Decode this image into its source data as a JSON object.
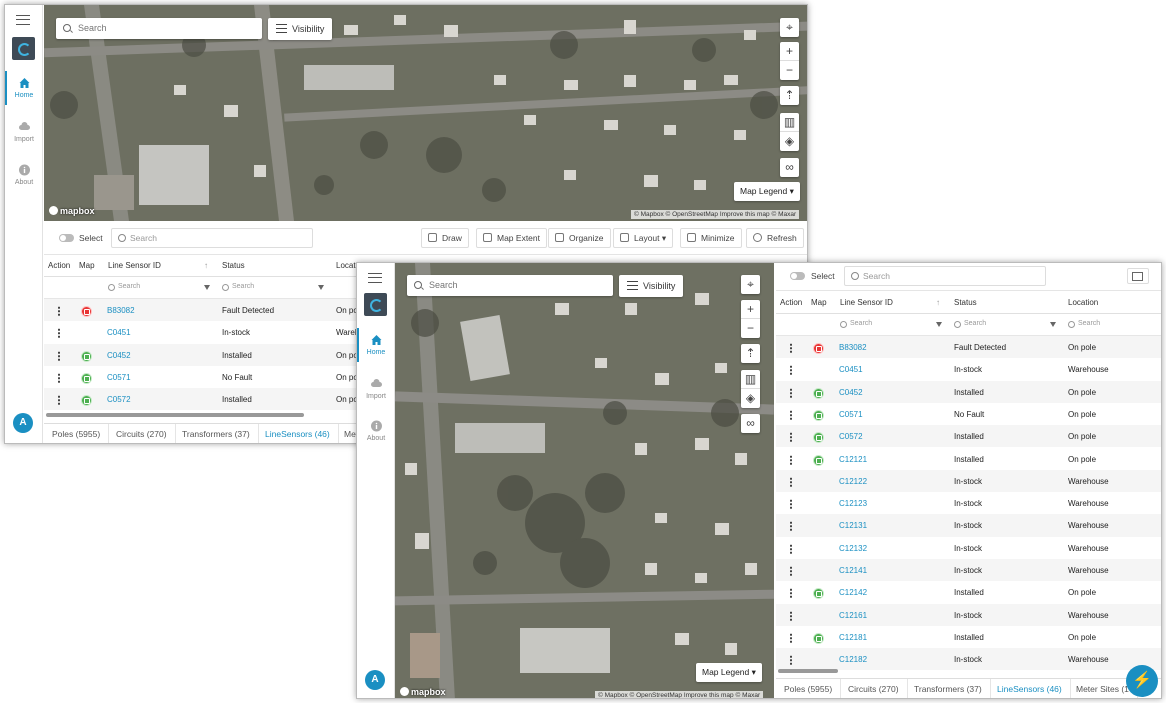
{
  "sidebar": {
    "items": [
      {
        "label": "Home"
      },
      {
        "label": "Import"
      },
      {
        "label": "About"
      }
    ],
    "avatar": "A"
  },
  "map": {
    "search_placeholder": "Search",
    "visibility_label": "Visibility",
    "legend_label": "Map Legend",
    "mapbox_logo": "mapbox",
    "attribution": "© Mapbox © OpenStreetMap Improve this map © Maxar",
    "controls": [
      "locate",
      "zoom-in",
      "zoom-out",
      "compass",
      "basemap",
      "layers",
      "binoculars"
    ]
  },
  "toolbar": {
    "select_label": "Select",
    "search_placeholder": "Search",
    "buttons": [
      "Draw",
      "Map Extent",
      "Organize",
      "Layout",
      "Minimize",
      "Refresh"
    ]
  },
  "grid": {
    "headers": [
      "Action",
      "Map",
      "Line Sensor ID",
      "Status",
      "Location"
    ],
    "filter_placeholder": "Search",
    "rows": [
      {
        "id": "B83082",
        "status": "Fault Detected",
        "location": "On pole",
        "map": "red"
      },
      {
        "id": "C0451",
        "status": "In-stock",
        "location": "Warehouse",
        "map": ""
      },
      {
        "id": "C0452",
        "status": "Installed",
        "location": "On pole",
        "map": "green"
      },
      {
        "id": "C0571",
        "status": "No Fault",
        "location": "On pole",
        "map": "green"
      },
      {
        "id": "C0572",
        "status": "Installed",
        "location": "On pole",
        "map": "green"
      },
      {
        "id": "C12121",
        "status": "Installed",
        "location": "On pole",
        "map": "green"
      },
      {
        "id": "C12122",
        "status": "In-stock",
        "location": "Warehouse",
        "map": ""
      },
      {
        "id": "C12123",
        "status": "In-stock",
        "location": "Warehouse",
        "map": ""
      },
      {
        "id": "C12131",
        "status": "In-stock",
        "location": "Warehouse",
        "map": ""
      },
      {
        "id": "C12132",
        "status": "In-stock",
        "location": "Warehouse",
        "map": ""
      },
      {
        "id": "C12141",
        "status": "In-stock",
        "location": "Warehouse",
        "map": ""
      },
      {
        "id": "C12142",
        "status": "Installed",
        "location": "On pole",
        "map": "green"
      },
      {
        "id": "C12161",
        "status": "In-stock",
        "location": "Warehouse",
        "map": ""
      },
      {
        "id": "C12181",
        "status": "Installed",
        "location": "On pole",
        "map": "green"
      },
      {
        "id": "C12182",
        "status": "In-stock",
        "location": "Warehouse",
        "map": ""
      }
    ],
    "truncated_location": "On pol",
    "truncated_location_wh": "Wareho"
  },
  "tabs": [
    {
      "label": "Poles (5955)"
    },
    {
      "label": "Circuits (270)"
    },
    {
      "label": "Transformers (37)"
    },
    {
      "label": "LineSensors (46)"
    },
    {
      "label": "Meter Sites (1"
    }
  ],
  "tab_w1_last": "Met",
  "colors": {
    "accent": "#1a8fc2",
    "fault": "#e83535",
    "ok": "#4caf50"
  }
}
